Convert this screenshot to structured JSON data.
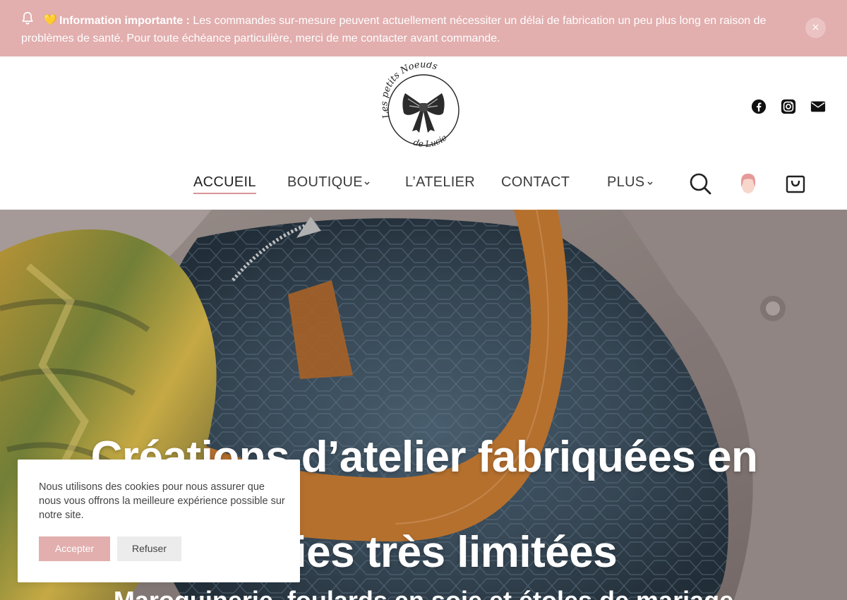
{
  "notice": {
    "emoji": "💛",
    "bold_label": "Information importante :",
    "message": " Les commandes sur-mesure peuvent actuellement nécessiter un délai de fabrication un peu plus long en raison de problèmes de santé. Pour toute échéance particulière, merci de me contacter avant commande.",
    "close_symbol": "×",
    "background": "#e2aeae"
  },
  "brand": {
    "logo_icon": "bow-logo",
    "logo_text_top": "Les petits Noeuds",
    "logo_text_bottom": "de Lucie"
  },
  "social": [
    "facebook-icon",
    "instagram-icon",
    "mail-icon"
  ],
  "nav": {
    "items": [
      {
        "label": "ACCUEIL",
        "active": true,
        "has_dropdown": false
      },
      {
        "label": "BOUTIQUE",
        "active": false,
        "has_dropdown": true
      },
      {
        "label": "L’ATELIER",
        "active": false,
        "has_dropdown": false
      },
      {
        "label": "CONTACT",
        "active": false,
        "has_dropdown": false
      },
      {
        "label": "PLUS",
        "active": false,
        "has_dropdown": true
      }
    ],
    "accent": "#d99595",
    "icons": [
      "search-icon",
      "account-icon",
      "cart-icon"
    ]
  },
  "hero": {
    "title_line1": "Créations d’atelier fabriquées en",
    "title_line2": "séries très limitées",
    "subtitle": "Maroquinerie, foulards en soie et étoles de mariage"
  },
  "cookie": {
    "message": "Nous utilisons des cookies pour nous assurer que nous vous offrons la meilleure expérience possible sur notre site.",
    "accept_label": "Accepter",
    "refuse_label": "Refuser"
  }
}
